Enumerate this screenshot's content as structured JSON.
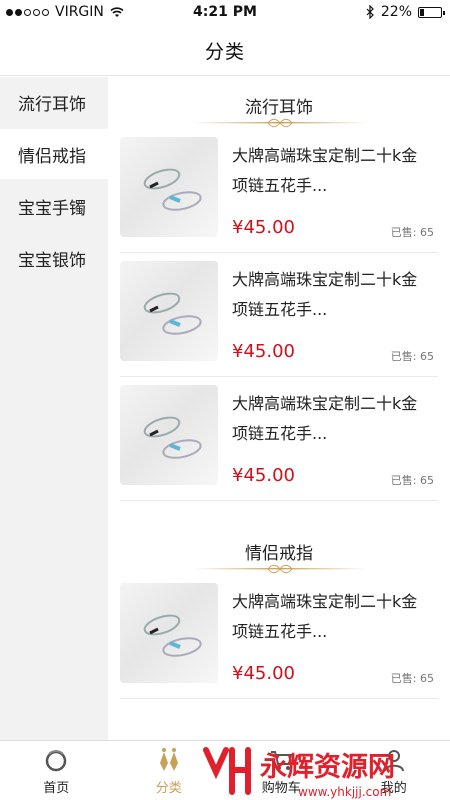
{
  "status_bar": {
    "carrier": "VIRGIN",
    "time": "4:21 PM",
    "battery": "22%",
    "battery_level": 0.22
  },
  "header": {
    "title": "分类"
  },
  "sidebar": {
    "items": [
      {
        "label": "流行耳饰"
      },
      {
        "label": "情侣戒指"
      },
      {
        "label": "宝宝手镯"
      },
      {
        "label": "宝宝银饰"
      }
    ]
  },
  "sections": [
    {
      "title": "流行耳饰",
      "products": [
        {
          "title": "大牌高端珠宝定制二十k金项链五花手...",
          "price": "¥45.00",
          "sold": "已售: 65"
        },
        {
          "title": "大牌高端珠宝定制二十k金项链五花手...",
          "price": "¥45.00",
          "sold": "已售: 65"
        },
        {
          "title": "大牌高端珠宝定制二十k金项链五花手...",
          "price": "¥45.00",
          "sold": "已售: 65"
        }
      ]
    },
    {
      "title": "情侣戒指",
      "products": [
        {
          "title": "大牌高端珠宝定制二十k金项链五花手...",
          "price": "¥45.00",
          "sold": "已售: 65"
        }
      ]
    }
  ],
  "tab_bar": {
    "tabs": [
      {
        "label": "首页",
        "icon": "home-ring-icon"
      },
      {
        "label": "分类",
        "icon": "earring-icon"
      },
      {
        "label": "购物车",
        "icon": "cart-icon"
      },
      {
        "label": "我的",
        "icon": "profile-icon"
      }
    ]
  },
  "watermark": {
    "text": "永辉资源网",
    "url": "www.yhkjjj.com"
  },
  "colors": {
    "accent": "#c9a058",
    "price": "#d0101a",
    "sidebar_bg": "#f2f2f2"
  }
}
